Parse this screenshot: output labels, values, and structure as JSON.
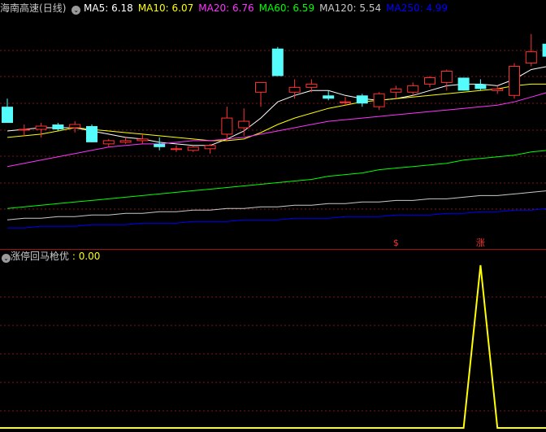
{
  "main_panel": {
    "stock_name": "海南高速",
    "period": "(日线)",
    "indicators": [
      {
        "label": "MA5: ",
        "value": "6.18",
        "color": "#ffffff"
      },
      {
        "label": "MA10: ",
        "value": "6.07",
        "color": "#ffff00"
      },
      {
        "label": "MA20: ",
        "value": "6.76",
        "color": "#ff33ff"
      },
      {
        "label": "MA60: ",
        "value": "6.59",
        "color": "#00ff00"
      },
      {
        "label": "MA120: ",
        "value": "5.54",
        "color": "#c8c8c8"
      },
      {
        "label": "MA250: ",
        "value": "4.99",
        "color": "#0000ff"
      }
    ]
  },
  "sub_panel": {
    "indicator_name": "涨停回马枪优",
    "value_text": ": 0.00",
    "value_color": "#ffff00"
  },
  "colors": {
    "background": "#000000",
    "up_candle": "#ff3232",
    "down_candle": "#54fcfc",
    "grid": "#7a1a1a",
    "divider": "#a01010"
  },
  "chart_data": [
    {
      "type": "candlestick",
      "title": "海南高速 (日线)",
      "candles": [
        {
          "open": 5.93,
          "high": 5.98,
          "low": 5.83,
          "close": 5.83
        },
        {
          "open": 5.79,
          "high": 5.82,
          "low": 5.75,
          "close": 5.79
        },
        {
          "open": 5.79,
          "high": 5.83,
          "low": 5.74,
          "close": 5.81
        },
        {
          "open": 5.82,
          "high": 5.83,
          "low": 5.78,
          "close": 5.79
        },
        {
          "open": 5.8,
          "high": 5.84,
          "low": 5.77,
          "close": 5.82
        },
        {
          "open": 5.81,
          "high": 5.82,
          "low": 5.71,
          "close": 5.71
        },
        {
          "open": 5.7,
          "high": 5.73,
          "low": 5.68,
          "close": 5.72
        },
        {
          "open": 5.71,
          "high": 5.74,
          "low": 5.7,
          "close": 5.72
        },
        {
          "open": 5.72,
          "high": 5.76,
          "low": 5.7,
          "close": 5.73
        },
        {
          "open": 5.7,
          "high": 5.74,
          "low": 5.66,
          "close": 5.68
        },
        {
          "open": 5.67,
          "high": 5.69,
          "low": 5.65,
          "close": 5.67
        },
        {
          "open": 5.66,
          "high": 5.69,
          "low": 5.65,
          "close": 5.68
        },
        {
          "open": 5.67,
          "high": 5.7,
          "low": 5.64,
          "close": 5.69
        },
        {
          "open": 5.76,
          "high": 5.93,
          "low": 5.72,
          "close": 5.86
        },
        {
          "open": 5.8,
          "high": 5.92,
          "low": 5.75,
          "close": 5.84
        },
        {
          "open": 6.02,
          "high": 6.04,
          "low": 5.93,
          "close": 6.08
        },
        {
          "open": 6.29,
          "high": 6.3,
          "low": 6.12,
          "close": 6.12
        },
        {
          "open": 6.02,
          "high": 6.1,
          "low": 5.98,
          "close": 6.05
        },
        {
          "open": 6.05,
          "high": 6.1,
          "low": 6.02,
          "close": 6.07
        },
        {
          "open": 6.0,
          "high": 6.03,
          "low": 5.97,
          "close": 5.98
        },
        {
          "open": 5.96,
          "high": 5.99,
          "low": 5.94,
          "close": 5.96
        },
        {
          "open": 6.0,
          "high": 6.01,
          "low": 5.93,
          "close": 5.95
        },
        {
          "open": 5.93,
          "high": 6.02,
          "low": 5.91,
          "close": 6.01
        },
        {
          "open": 6.02,
          "high": 6.06,
          "low": 5.98,
          "close": 6.04
        },
        {
          "open": 6.02,
          "high": 6.08,
          "low": 6.0,
          "close": 6.06
        },
        {
          "open": 6.07,
          "high": 6.12,
          "low": 6.05,
          "close": 6.11
        },
        {
          "open": 6.08,
          "high": 6.16,
          "low": 6.03,
          "close": 6.15
        },
        {
          "open": 6.11,
          "high": 6.1,
          "low": 6.03,
          "close": 6.03
        },
        {
          "open": 6.07,
          "high": 6.1,
          "low": 6.03,
          "close": 6.04
        },
        {
          "open": 6.03,
          "high": 6.06,
          "low": 6.01,
          "close": 6.04
        },
        {
          "open": 6.0,
          "high": 6.2,
          "low": 5.98,
          "close": 6.18
        },
        {
          "open": 6.2,
          "high": 6.38,
          "low": 6.18,
          "close": 6.27
        },
        {
          "open": 6.32,
          "high": 6.4,
          "low": 6.2,
          "close": 6.24
        }
      ],
      "ma_lines": [
        {
          "name": "MA5",
          "color": "#ffffff",
          "values": [
            5.78,
            5.79,
            5.8,
            5.8,
            5.8,
            5.78,
            5.76,
            5.74,
            5.73,
            5.71,
            5.7,
            5.69,
            5.69,
            5.73,
            5.78,
            5.86,
            5.96,
            6.0,
            6.03,
            6.03,
            6.0,
            5.98,
            5.97,
            5.98,
            6.0,
            6.03,
            6.06,
            6.07,
            6.07,
            6.06,
            6.1,
            6.16,
            6.18
          ]
        },
        {
          "name": "MA10",
          "color": "#ffff00",
          "values": [
            5.74,
            5.75,
            5.76,
            5.78,
            5.8,
            5.79,
            5.78,
            5.77,
            5.76,
            5.75,
            5.74,
            5.73,
            5.72,
            5.72,
            5.73,
            5.77,
            5.82,
            5.86,
            5.89,
            5.92,
            5.94,
            5.96,
            5.97,
            5.98,
            5.99,
            6.0,
            6.01,
            6.02,
            6.03,
            6.04,
            6.06,
            6.07,
            6.07
          ]
        },
        {
          "name": "MA20",
          "color": "#ff33ff",
          "values": [
            5.56,
            5.58,
            5.6,
            5.62,
            5.64,
            5.66,
            5.68,
            5.69,
            5.7,
            5.7,
            5.71,
            5.72,
            5.72,
            5.73,
            5.74,
            5.76,
            5.78,
            5.8,
            5.82,
            5.84,
            5.85,
            5.86,
            5.87,
            5.88,
            5.89,
            5.9,
            5.91,
            5.92,
            5.93,
            5.94,
            5.96,
            5.99,
            6.02
          ]
        },
        {
          "name": "MA60",
          "color": "#00ff00",
          "values": [
            5.3,
            5.31,
            5.32,
            5.33,
            5.34,
            5.35,
            5.36,
            5.37,
            5.38,
            5.39,
            5.4,
            5.41,
            5.42,
            5.43,
            5.44,
            5.45,
            5.46,
            5.47,
            5.48,
            5.5,
            5.51,
            5.52,
            5.54,
            5.55,
            5.56,
            5.57,
            5.58,
            5.6,
            5.61,
            5.62,
            5.63,
            5.65,
            5.66
          ]
        },
        {
          "name": "MA120",
          "color": "#c8c8c8",
          "values": [
            5.23,
            5.24,
            5.24,
            5.25,
            5.25,
            5.26,
            5.26,
            5.27,
            5.27,
            5.28,
            5.28,
            5.29,
            5.29,
            5.3,
            5.3,
            5.31,
            5.31,
            5.32,
            5.32,
            5.33,
            5.33,
            5.34,
            5.34,
            5.35,
            5.35,
            5.36,
            5.36,
            5.37,
            5.38,
            5.38,
            5.39,
            5.4,
            5.41
          ]
        },
        {
          "name": "MA250",
          "color": "#0000ff",
          "values": [
            5.18,
            5.18,
            5.19,
            5.19,
            5.19,
            5.2,
            5.2,
            5.2,
            5.21,
            5.21,
            5.21,
            5.22,
            5.22,
            5.22,
            5.23,
            5.23,
            5.23,
            5.24,
            5.24,
            5.24,
            5.25,
            5.25,
            5.25,
            5.26,
            5.26,
            5.26,
            5.27,
            5.27,
            5.28,
            5.28,
            5.29,
            5.29,
            5.3
          ]
        }
      ],
      "markers": [
        {
          "index": 23,
          "text": "$",
          "color": "#ff3232"
        },
        {
          "index": 28,
          "text": "涨",
          "color": "#ff3232"
        }
      ]
    },
    {
      "type": "line",
      "title": "涨停回马枪优",
      "series": [
        {
          "color": "#ffff00",
          "values": [
            0,
            0,
            0,
            0,
            0,
            0,
            0,
            0,
            0,
            0,
            0,
            0,
            0,
            0,
            0,
            0,
            0,
            0,
            0,
            0,
            0,
            0,
            0,
            0,
            0,
            0,
            0,
            0,
            1,
            0,
            0,
            0,
            0
          ]
        }
      ],
      "ylim": [
        0,
        1
      ]
    }
  ]
}
